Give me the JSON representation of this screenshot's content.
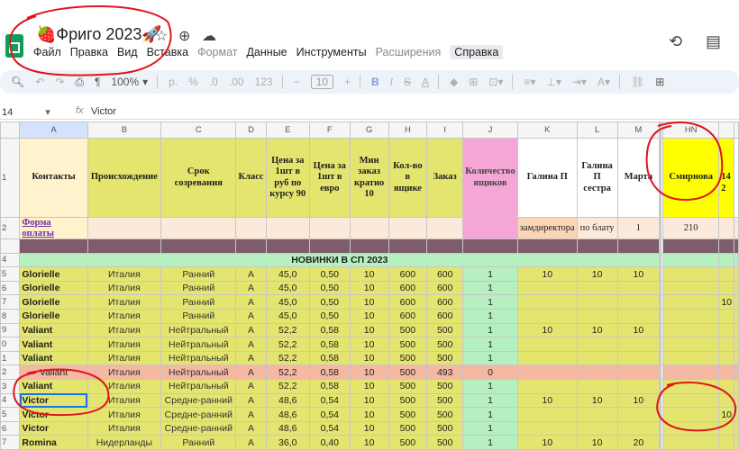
{
  "doc": {
    "title": "Фриго 2023",
    "title_emoji_left": "🍓",
    "title_emoji_right": "🚀"
  },
  "menu": [
    "Файл",
    "Правка",
    "Вид",
    "Вставка",
    "Формат",
    "Данные",
    "Инструменты",
    "Расширения",
    "Справка"
  ],
  "menu_disabled": [
    "Формат",
    "Расширения"
  ],
  "menu_active": "Справка",
  "toolbar": {
    "zoom": "100%",
    "currency": "р.",
    "percent": "%",
    "dec_minus": ".0",
    "dec_plus": ".00",
    "number_format": "123",
    "font_size": "10"
  },
  "formula_bar": {
    "name_box": "14",
    "fx": "fx",
    "value": "Victor"
  },
  "columns": [
    "A",
    "B",
    "C",
    "D",
    "E",
    "F",
    "G",
    "H",
    "I",
    "J",
    "K",
    "L",
    "M",
    "HN",
    ""
  ],
  "header_row": {
    "row_num": "1",
    "cells": [
      "Контакты",
      "Происхождение",
      "Срок созревания",
      "Класс",
      "Цена за 1шт в руб по курсу 90",
      "Цена за 1шт в евро",
      "Мин заказ кратно 10",
      "Кол-во в ящике",
      "Заказ",
      "Количество ящиков",
      "Галина П",
      "Галина П сестра",
      "Марта",
      "Смирнова",
      "\n14\n2"
    ]
  },
  "row2": {
    "row_num": "2",
    "pay_link": "Форма оплаты",
    "cells": [
      "",
      "",
      "",
      "",
      "",
      "",
      "",
      "",
      "",
      "замдиректора",
      "по блату",
      "1",
      "210",
      ""
    ]
  },
  "band": {
    "row_num": "4",
    "text": "НОВИНКИ В СП 2023"
  },
  "rows": [
    {
      "n": "5",
      "c": [
        "Glorielle",
        "Италия",
        "Ранний",
        "A",
        "45,0",
        "0,50",
        "10",
        "600",
        "600",
        "1",
        "10",
        "10",
        "10",
        "",
        ""
      ],
      "style": "d"
    },
    {
      "n": "6",
      "c": [
        "Glorielle",
        "Италия",
        "Ранний",
        "A",
        "45,0",
        "0,50",
        "10",
        "600",
        "600",
        "1",
        "",
        "",
        "",
        "",
        ""
      ],
      "style": "d"
    },
    {
      "n": "7",
      "c": [
        "Glorielle",
        "Италия",
        "Ранний",
        "A",
        "45,0",
        "0,50",
        "10",
        "600",
        "600",
        "1",
        "",
        "",
        "",
        "",
        "10"
      ],
      "style": "d"
    },
    {
      "n": "8",
      "c": [
        "Glorielle",
        "Италия",
        "Ранний",
        "A",
        "45,0",
        "0,50",
        "10",
        "600",
        "600",
        "1",
        "",
        "",
        "",
        "",
        ""
      ],
      "style": "d"
    },
    {
      "n": "9",
      "c": [
        "Valiant",
        "Италия",
        "Нейтральный",
        "A",
        "52,2",
        "0,58",
        "10",
        "500",
        "500",
        "1",
        "10",
        "10",
        "10",
        "",
        ""
      ],
      "style": "d"
    },
    {
      "n": "0",
      "c": [
        "Valiant",
        "Италия",
        "Нейтральный",
        "A",
        "52,2",
        "0,58",
        "10",
        "500",
        "500",
        "1",
        "",
        "",
        "",
        "",
        ""
      ],
      "style": "d"
    },
    {
      "n": "1",
      "c": [
        "Valiant",
        "Италия",
        "Нейтральный",
        "A",
        "52,2",
        "0,58",
        "10",
        "500",
        "500",
        "1",
        "",
        "",
        "",
        "",
        ""
      ],
      "style": "d"
    },
    {
      "n": "2",
      "c": [
        "Valiant",
        "Италия",
        "Нейтральный",
        "A",
        "52,2",
        "0,58",
        "10",
        "500",
        "493",
        "0",
        "",
        "",
        "",
        "",
        ""
      ],
      "style": "salmon"
    },
    {
      "n": "3",
      "c": [
        "Valiant",
        "Италия",
        "Нейтральный",
        "A",
        "52,2",
        "0,58",
        "10",
        "500",
        "500",
        "1",
        "",
        "",
        "",
        "",
        ""
      ],
      "style": "d"
    },
    {
      "n": "4",
      "c": [
        "Victor",
        "Италия",
        "Средне-ранний",
        "A",
        "48,6",
        "0,54",
        "10",
        "500",
        "500",
        "1",
        "10",
        "10",
        "10",
        "",
        ""
      ],
      "style": "d",
      "selected": true
    },
    {
      "n": "5",
      "c": [
        "Victor",
        "Италия",
        "Средне-ранний",
        "A",
        "48,6",
        "0,54",
        "10",
        "500",
        "500",
        "1",
        "",
        "",
        "",
        "",
        "10"
      ],
      "style": "d"
    },
    {
      "n": "6",
      "c": [
        "Victor",
        "Италия",
        "Средне-ранний",
        "A",
        "48,6",
        "0,54",
        "10",
        "500",
        "500",
        "1",
        "",
        "",
        "",
        "",
        ""
      ],
      "style": "d"
    },
    {
      "n": "7",
      "c": [
        "Romina",
        "Нидерланды",
        "Ранний",
        "A",
        "36,0",
        "0,40",
        "10",
        "500",
        "500",
        "1",
        "10",
        "10",
        "20",
        "",
        ""
      ],
      "style": "d"
    }
  ],
  "colors": {
    "yellow_green": "#e4e56f",
    "pink": "#f4a7d6",
    "mint": "#b7f0c0",
    "salmon": "#f4b8a3",
    "bright_yellow": "#ffff00",
    "annotation_red": "#e0141e",
    "selection_blue": "#1a73e8"
  },
  "icons": [
    "sheets-logo-icon",
    "star-icon",
    "move-folder-icon",
    "cloud-status-icon",
    "history-icon",
    "comments-icon",
    "search-icon",
    "undo-icon",
    "redo-icon",
    "print-icon",
    "paint-format-icon"
  ]
}
